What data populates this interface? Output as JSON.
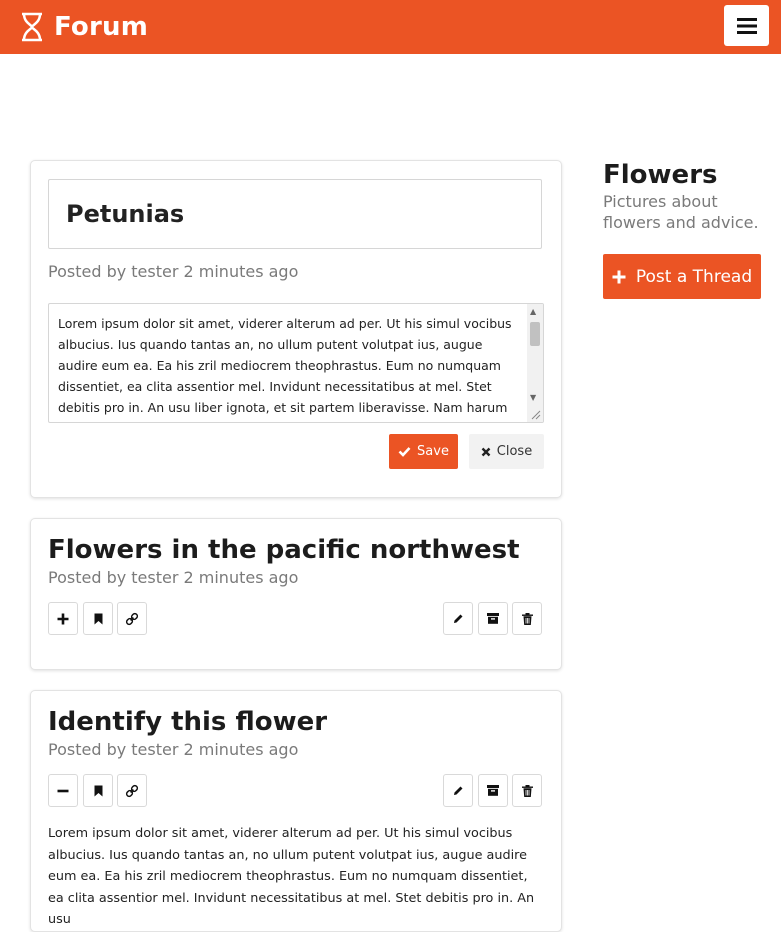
{
  "header": {
    "brand_title": "Forum",
    "logo_icon": "hourglass-icon",
    "menu_icon": "hamburger-menu-icon",
    "accent_color": "#eb5424"
  },
  "edit_post": {
    "title_value": "Petunias",
    "meta": "Posted by tester 2 minutes ago",
    "body_value": "Lorem ipsum dolor sit amet, viderer alterum ad per. Ut his simul vocibus albucius. Ius quando tantas an, no ullum putent volutpat ius, augue audire eum ea. Ea his zril mediocrem theophrastus. Eum no numquam dissentiet, ea clita assentior mel. Invidunt necessitatibus at mel. Stet debitis pro in. An usu liber ignota, et sit partem liberavisse. Nam harum",
    "save_label": "Save",
    "close_label": "Close"
  },
  "threads": [
    {
      "title": "Flowers in the pacific northwest",
      "meta": "Posted by tester 2 minutes ago",
      "expand_icon": "plus-icon"
    },
    {
      "title": "Identify this flower",
      "meta": "Posted by tester 2 minutes ago",
      "expand_icon": "minus-icon",
      "body": "Lorem ipsum dolor sit amet, viderer alterum ad per. Ut his simul vocibus albucius. Ius quando tantas an, no ullum putent volutpat ius, augue audire eum ea. Ea his zril mediocrem theophrastus. Eum no numquam dissentiet, ea clita assentior mel. Invidunt necessitatibus at mel. Stet debitis pro in. An usu"
    }
  ],
  "sidebar": {
    "title": "Flowers",
    "description": "Pictures about flowers and advice.",
    "post_button_label": "Post a Thread"
  }
}
